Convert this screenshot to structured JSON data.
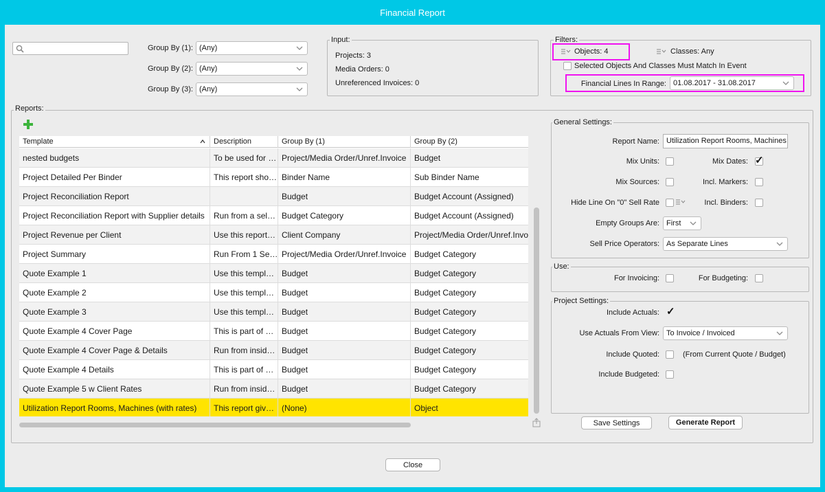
{
  "window": {
    "title": "Financial Report"
  },
  "search": {
    "placeholder": ""
  },
  "group_by": [
    {
      "label": "Group By (1):",
      "value": "(Any)"
    },
    {
      "label": "Group By (2):",
      "value": "(Any)"
    },
    {
      "label": "Group By (3):",
      "value": "(Any)"
    }
  ],
  "input_box": {
    "title": "Input:",
    "projects": "Projects: 3",
    "media_orders": "Media Orders: 0",
    "unreferenced_invoices": "Unreferenced Invoices: 0"
  },
  "filters": {
    "title": "Filters:",
    "objects": "Objects: 4",
    "classes": "Classes: Any",
    "match_label": "Selected Objects And Classes Must Match In Event",
    "range_label": "Financial Lines In Range:",
    "range_value": "01.08.2017 - 31.08.2017"
  },
  "reports": {
    "title": "Reports:",
    "columns": [
      "Template",
      "Description",
      "Group By (1)",
      "Group By (2)"
    ],
    "rows": [
      [
        "nested budgets",
        "To be used for …",
        "Project/Media Order/Unref.Invoice",
        "Budget"
      ],
      [
        "Project Detailed Per Binder",
        "This report sho…",
        "Binder Name",
        "Sub Binder Name"
      ],
      [
        "Project Reconciliation Report",
        "",
        "Budget",
        "Budget Account (Assigned)"
      ],
      [
        "Project Reconciliation Report with Supplier details",
        "Run from a sel…",
        "Budget Category",
        "Budget Account (Assigned)"
      ],
      [
        "Project Revenue per Client",
        "Use this report…",
        "Client Company",
        "Project/Media Order/Unref.Invo"
      ],
      [
        "Project Summary",
        "Run From 1 Se…",
        "Project/Media Order/Unref.Invoice",
        "Budget Category"
      ],
      [
        "Quote Example 1",
        "Use this templ…",
        "Budget",
        "Budget Category"
      ],
      [
        "Quote Example 2",
        "Use this templ…",
        "Budget",
        "Budget Category"
      ],
      [
        "Quote Example 3",
        "Use this templ…",
        "Budget",
        "Budget Category"
      ],
      [
        "Quote Example 4 Cover Page",
        "This is part of …",
        "Budget",
        "Budget Category"
      ],
      [
        "Quote Example 4 Cover Page & Details",
        "Run from insid…",
        "Budget",
        "Budget Category"
      ],
      [
        "Quote Example 4 Details",
        "This is part of …",
        "Budget",
        "Budget Category"
      ],
      [
        "Quote Example 5 w Client Rates",
        "Run from insid…",
        "Budget",
        "Budget Category"
      ],
      [
        "Utilization Report Rooms, Machines (with rates)",
        "This report giv…",
        "(None)",
        "Object"
      ]
    ]
  },
  "general_settings": {
    "title": "General Settings:",
    "report_name_label": "Report Name:",
    "report_name_value": "Utilization Report Rooms, Machines",
    "mix_units": "Mix Units:",
    "mix_dates": "Mix Dates:",
    "mix_sources": "Mix Sources:",
    "incl_markers": "Incl. Markers:",
    "hide_line_label": "Hide Line On \"0\" Sell Rate",
    "incl_binders": "Incl. Binders:",
    "empty_groups_label": "Empty Groups Are:",
    "empty_groups_value": "First",
    "sell_price_label": "Sell Price Operators:",
    "sell_price_value": "As Separate Lines"
  },
  "use_box": {
    "title": "Use:",
    "for_invoicing": "For Invoicing:",
    "for_budgeting": "For Budgeting:"
  },
  "project_settings": {
    "title": "Project Settings:",
    "include_actuals": "Include Actuals:",
    "use_actuals_label": "Use Actuals From View:",
    "use_actuals_value": "To Invoice / Invoiced",
    "include_quoted": "Include Quoted:",
    "include_quoted_note": "(From Current Quote / Budget)",
    "include_budgeted": "Include Budgeted:"
  },
  "buttons": {
    "save_settings": "Save Settings",
    "generate_report": "Generate Report",
    "close": "Close"
  },
  "colors": {
    "accent": "#00c8e6",
    "selected_row": "#ffe400",
    "highlight": "#f014f0",
    "add_icon": "#3cb43c"
  }
}
